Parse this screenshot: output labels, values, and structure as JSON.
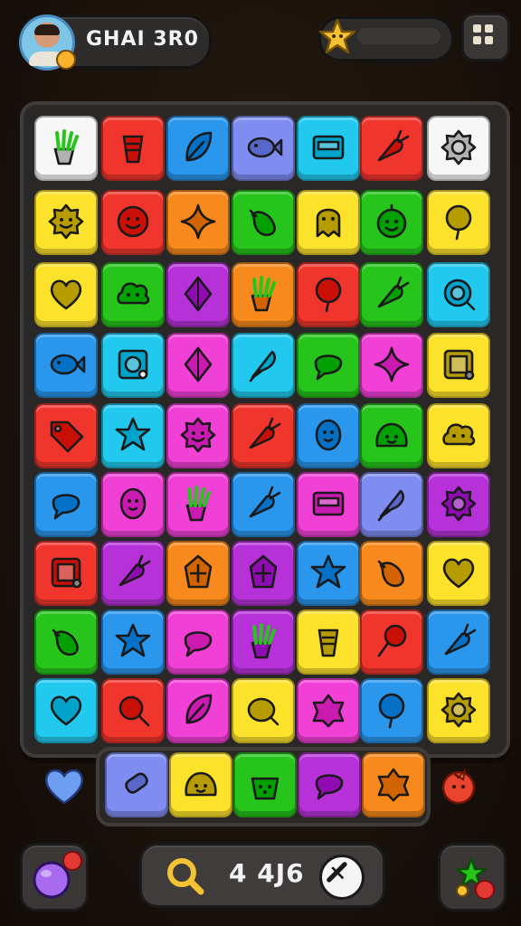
{
  "player": {
    "name": "GHAI 3R0"
  },
  "stars": {
    "progress": 0.0
  },
  "score": {
    "value": "4 4J6"
  },
  "colors": {
    "red": "#f0352d",
    "orange": "#f7891d",
    "yellow": "#fde22c",
    "green": "#27c51c",
    "cyan": "#22c9ef",
    "blue": "#2a96ec",
    "purple": "#b632d8",
    "pink": "#f040d6",
    "lilac": "#7f8cf0",
    "white": "#f7f7f7",
    "star": "#f4c233"
  },
  "grid": [
    [
      {
        "color": "white",
        "icon": "fries-icon"
      },
      {
        "color": "red",
        "icon": "drink-icon"
      },
      {
        "color": "blue",
        "icon": "leaf-icon"
      },
      {
        "color": "lilac",
        "icon": "fish-icon"
      },
      {
        "color": "cyan",
        "icon": "card-icon"
      },
      {
        "color": "red",
        "icon": "carrot-icon"
      },
      {
        "color": "white",
        "icon": "sunflower-icon"
      }
    ],
    [
      {
        "color": "yellow",
        "icon": "sun-face-icon"
      },
      {
        "color": "red",
        "icon": "smile-ring-icon"
      },
      {
        "color": "orange",
        "icon": "sparkle-icon"
      },
      {
        "color": "green",
        "icon": "eggplant-icon"
      },
      {
        "color": "yellow",
        "icon": "ghost-icon"
      },
      {
        "color": "green",
        "icon": "bomb-face-icon"
      },
      {
        "color": "yellow",
        "icon": "balloon-icon"
      }
    ],
    [
      {
        "color": "yellow",
        "icon": "heart-icon"
      },
      {
        "color": "green",
        "icon": "cloud-face-icon"
      },
      {
        "color": "purple",
        "icon": "diamond-icon"
      },
      {
        "color": "orange",
        "icon": "fries-icon"
      },
      {
        "color": "red",
        "icon": "balloon-icon"
      },
      {
        "color": "green",
        "icon": "carrot-icon"
      },
      {
        "color": "cyan",
        "icon": "search-face-icon"
      }
    ],
    [
      {
        "color": "blue",
        "icon": "fish-icon"
      },
      {
        "color": "cyan",
        "icon": "safe-icon"
      },
      {
        "color": "pink",
        "icon": "diamond-icon"
      },
      {
        "color": "cyan",
        "icon": "feather-icon"
      },
      {
        "color": "green",
        "icon": "speech-icon"
      },
      {
        "color": "pink",
        "icon": "sparkle-icon"
      },
      {
        "color": "yellow",
        "icon": "box-icon"
      }
    ],
    [
      {
        "color": "red",
        "icon": "tag-icon"
      },
      {
        "color": "cyan",
        "icon": "star-icon"
      },
      {
        "color": "pink",
        "icon": "flower-face-icon"
      },
      {
        "color": "red",
        "icon": "carrot-icon"
      },
      {
        "color": "blue",
        "icon": "egg-face-icon"
      },
      {
        "color": "green",
        "icon": "blob-face-icon"
      },
      {
        "color": "yellow",
        "icon": "cloud-face-icon"
      }
    ],
    [
      {
        "color": "blue",
        "icon": "speech-icon"
      },
      {
        "color": "pink",
        "icon": "egg-face-icon"
      },
      {
        "color": "pink",
        "icon": "fries-icon"
      },
      {
        "color": "blue",
        "icon": "carrot-icon"
      },
      {
        "color": "pink",
        "icon": "card-icon"
      },
      {
        "color": "lilac",
        "icon": "feather-icon"
      },
      {
        "color": "purple",
        "icon": "sunflower-icon"
      }
    ],
    [
      {
        "color": "red",
        "icon": "box-icon"
      },
      {
        "color": "purple",
        "icon": "carrot-icon"
      },
      {
        "color": "orange",
        "icon": "plus-leaf-icon"
      },
      {
        "color": "purple",
        "icon": "plus-leaf-icon"
      },
      {
        "color": "blue",
        "icon": "star-icon"
      },
      {
        "color": "orange",
        "icon": "eggplant-icon"
      },
      {
        "color": "yellow",
        "icon": "heart-icon"
      }
    ],
    [
      {
        "color": "green",
        "icon": "eggplant-icon"
      },
      {
        "color": "blue",
        "icon": "star-icon"
      },
      {
        "color": "pink",
        "icon": "speech-icon"
      },
      {
        "color": "purple",
        "icon": "fries-icon"
      },
      {
        "color": "yellow",
        "icon": "drink-icon"
      },
      {
        "color": "red",
        "icon": "paddle-icon"
      },
      {
        "color": "blue",
        "icon": "carrot-icon"
      }
    ],
    [
      {
        "color": "cyan",
        "icon": "heart-icon"
      },
      {
        "color": "red",
        "icon": "search-icon"
      },
      {
        "color": "pink",
        "icon": "leaf-icon"
      },
      {
        "color": "yellow",
        "icon": "meat-icon"
      },
      {
        "color": "pink",
        "icon": "flower-icon"
      },
      {
        "color": "blue",
        "icon": "balloon-icon"
      },
      {
        "color": "yellow",
        "icon": "sunflower-icon"
      }
    ]
  ],
  "tray": [
    {
      "color": "lilac",
      "icon": "candy-icon"
    },
    {
      "color": "yellow",
      "icon": "blob-face-icon"
    },
    {
      "color": "green",
      "icon": "basket-icon"
    },
    {
      "color": "purple",
      "icon": "speech-icon"
    },
    {
      "color": "orange",
      "icon": "flower-icon"
    }
  ]
}
